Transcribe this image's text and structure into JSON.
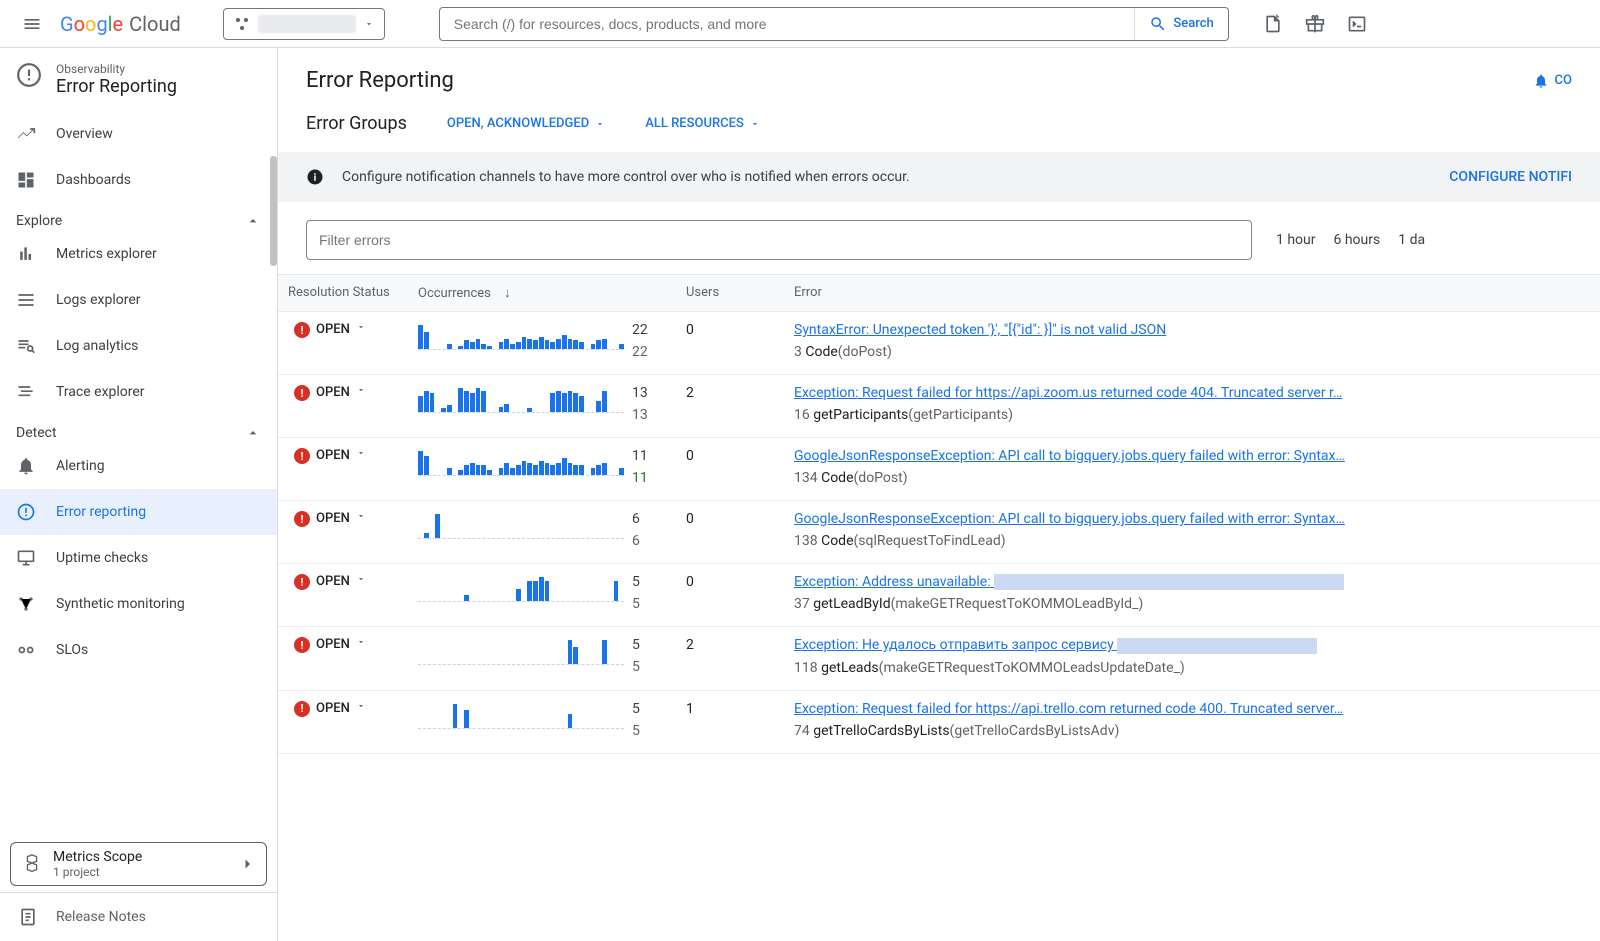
{
  "header": {
    "search_placeholder": "Search (/) for resources, docs, products, and more",
    "search_button": "Search"
  },
  "sidebar": {
    "category": "Observability",
    "title": "Error Reporting",
    "items_top": [
      {
        "label": "Overview"
      },
      {
        "label": "Dashboards"
      }
    ],
    "section_explore": "Explore",
    "items_explore": [
      {
        "label": "Metrics explorer"
      },
      {
        "label": "Logs explorer"
      },
      {
        "label": "Log analytics"
      },
      {
        "label": "Trace explorer"
      }
    ],
    "section_detect": "Detect",
    "items_detect": [
      {
        "label": "Alerting"
      },
      {
        "label": "Error reporting"
      },
      {
        "label": "Uptime checks"
      },
      {
        "label": "Synthetic monitoring"
      },
      {
        "label": "SLOs"
      }
    ],
    "metrics_scope": {
      "title": "Metrics Scope",
      "subtitle": "1 project"
    },
    "release_notes": "Release Notes"
  },
  "page": {
    "title": "Error Reporting",
    "co_label": "CO",
    "groups_title": "Error Groups",
    "filter_status": "OPEN, ACKNOWLEDGED",
    "filter_resources": "ALL RESOURCES",
    "banner_text": "Configure notification channels to have more control over who is notified when errors occur.",
    "banner_action": "CONFIGURE NOTIFI",
    "filter_input_placeholder": "Filter errors",
    "time_ranges": [
      "1 hour",
      "6 hours",
      "1 da"
    ]
  },
  "columns": {
    "status": "Resolution Status",
    "occurrences": "Occurrences",
    "users": "Users",
    "error": "Error"
  },
  "rows": [
    {
      "status": "OPEN",
      "occ1": "22",
      "occ2": "22",
      "users": "0",
      "error": "SyntaxError: Unexpected token '}', \"[{\"id\": }]\" is not valid JSON",
      "line": "3",
      "fn": "Code",
      "args": "(doPost)",
      "spark": [
        14,
        10,
        0,
        0,
        0,
        3,
        0,
        2,
        5,
        4,
        6,
        3,
        2,
        0,
        4,
        6,
        3,
        4,
        7,
        6,
        5,
        7,
        5,
        4,
        6,
        8,
        6,
        5,
        4,
        0,
        3,
        5,
        6,
        0,
        0,
        3
      ]
    },
    {
      "status": "OPEN",
      "occ1": "13",
      "occ2": "13",
      "users": "2",
      "error": "Exception: Request failed for https://api.zoom.us returned code 404. Truncated server r…",
      "line": "16",
      "fn": "getParticipants",
      "args": "(getParticipants)",
      "spark": [
        12,
        16,
        14,
        0,
        3,
        5,
        0,
        18,
        16,
        14,
        18,
        16,
        0,
        0,
        4,
        6,
        0,
        0,
        0,
        3,
        0,
        0,
        0,
        14,
        16,
        14,
        16,
        14,
        12,
        0,
        0,
        8,
        16,
        0,
        0,
        0
      ]
    },
    {
      "status": "OPEN",
      "occ1": "11",
      "occ2": "11",
      "users": "0",
      "error": "GoogleJsonResponseException: API call to bigquery.jobs.query failed with error: Syntax…",
      "line": "134",
      "fn": "Code",
      "args": "(doPost)",
      "spark": [
        10,
        8,
        0,
        0,
        0,
        3,
        0,
        2,
        4,
        5,
        4,
        4,
        2,
        0,
        3,
        5,
        3,
        4,
        6,
        5,
        4,
        6,
        5,
        4,
        5,
        7,
        5,
        4,
        4,
        0,
        3,
        4,
        5,
        0,
        0,
        3
      ]
    },
    {
      "status": "OPEN",
      "occ1": "6",
      "occ2": "6",
      "users": "0",
      "error": "GoogleJsonResponseException: API call to bigquery.jobs.query failed with error: Syntax…",
      "line": "138",
      "fn": "Code",
      "args": "(sqlRequestToFindLead)",
      "spark": [
        0,
        3,
        0,
        14,
        0,
        0,
        0,
        0,
        0,
        0,
        0,
        0,
        0,
        0,
        0,
        0,
        0,
        0,
        0,
        0,
        0,
        0,
        0,
        0,
        0,
        0,
        0,
        0,
        0,
        0,
        0,
        0,
        0,
        0,
        0,
        0
      ]
    },
    {
      "status": "OPEN",
      "occ1": "5",
      "occ2": "5",
      "users": "0",
      "error": "Exception: Address unavailable:",
      "line": "37",
      "fn": "getLeadById",
      "args": "(makeGETRequestToKOMMOLeadById_)",
      "spark": [
        0,
        0,
        0,
        0,
        0,
        0,
        0,
        0,
        3,
        0,
        0,
        0,
        0,
        0,
        0,
        0,
        0,
        6,
        0,
        10,
        10,
        12,
        10,
        0,
        0,
        0,
        0,
        0,
        0,
        0,
        0,
        0,
        0,
        0,
        10,
        0
      ],
      "blur": true
    },
    {
      "status": "OPEN",
      "occ1": "5",
      "occ2": "5",
      "users": "2",
      "error": "Exception: Не удалось отправить запрос сервису",
      "line": "118",
      "fn": "getLeads",
      "args": "(makeGETRequestToKOMMOLeadsUpdateDate_)",
      "spark": [
        0,
        0,
        0,
        0,
        0,
        0,
        0,
        0,
        0,
        0,
        0,
        0,
        0,
        0,
        0,
        0,
        0,
        0,
        0,
        0,
        0,
        0,
        0,
        0,
        0,
        0,
        14,
        10,
        0,
        0,
        0,
        0,
        14,
        0,
        0,
        0
      ],
      "blur": "short"
    },
    {
      "status": "OPEN",
      "occ1": "5",
      "occ2": "5",
      "users": "1",
      "error": "Exception: Request failed for https://api.trello.com returned code 400. Truncated server…",
      "line": "74",
      "fn": "getTrelloCardsByLists",
      "args": "(getTrelloCardsByListsAdv)",
      "spark": [
        0,
        0,
        0,
        0,
        0,
        0,
        14,
        0,
        10,
        0,
        0,
        0,
        0,
        0,
        0,
        0,
        0,
        0,
        0,
        0,
        0,
        0,
        0,
        0,
        0,
        0,
        8,
        0,
        0,
        0,
        0,
        0,
        0,
        0,
        0,
        0
      ]
    }
  ]
}
